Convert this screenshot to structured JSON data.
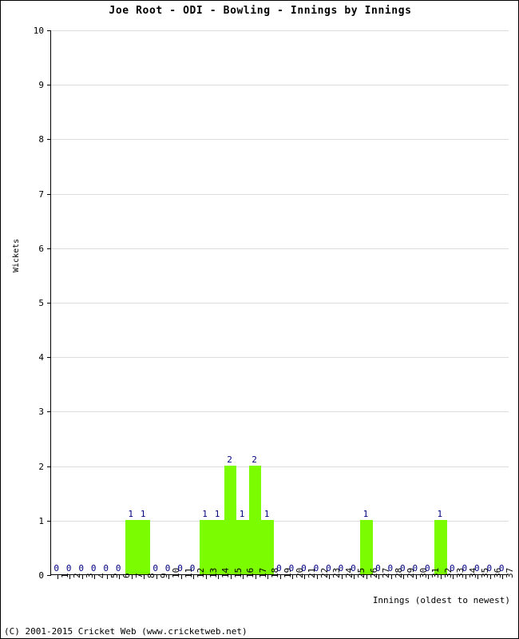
{
  "chart_data": {
    "type": "bar",
    "title": "Joe Root - ODI - Bowling - Innings by Innings",
    "xlabel": "Innings (oldest to newest)",
    "ylabel": "Wickets",
    "ylim": [
      0,
      10
    ],
    "ytick_step": 1,
    "yticks": [
      "0",
      "1",
      "2",
      "3",
      "4",
      "5",
      "6",
      "7",
      "8",
      "9",
      "10"
    ],
    "grid": true,
    "grid_axis": "y",
    "legend": false,
    "bar_color": "#7CFC00",
    "label_color": "#000080",
    "grid_color": "#DCDCDC",
    "axis_color": "#000000",
    "categories": [
      "1",
      "2",
      "3",
      "4",
      "5",
      "6",
      "7",
      "8",
      "9",
      "10",
      "11",
      "12",
      "13",
      "14",
      "15",
      "16",
      "17",
      "18",
      "19",
      "20",
      "21",
      "22",
      "23",
      "24",
      "25",
      "26",
      "27",
      "28",
      "29",
      "30",
      "31",
      "32",
      "33",
      "34",
      "35",
      "36",
      "37"
    ],
    "values": [
      0,
      0,
      0,
      0,
      0,
      0,
      1,
      1,
      0,
      0,
      0,
      0,
      1,
      1,
      2,
      1,
      2,
      1,
      0,
      0,
      0,
      0,
      0,
      0,
      0,
      1,
      0,
      0,
      0,
      0,
      0,
      1,
      0,
      0,
      0,
      0,
      0
    ],
    "point_labels": [
      "0",
      "0",
      "0",
      "0",
      "0",
      "0",
      "1",
      "1",
      "0",
      "0",
      "0",
      "0",
      "1",
      "1",
      "2",
      "1",
      "2",
      "1",
      "0",
      "0",
      "0",
      "0",
      "0",
      "0",
      "0",
      "1",
      "0",
      "0",
      "0",
      "0",
      "0",
      "1",
      "0",
      "0",
      "0",
      "0",
      "0"
    ]
  },
  "footer": {
    "copyright": "(C) 2001-2015 Cricket Web (www.cricketweb.net)"
  }
}
